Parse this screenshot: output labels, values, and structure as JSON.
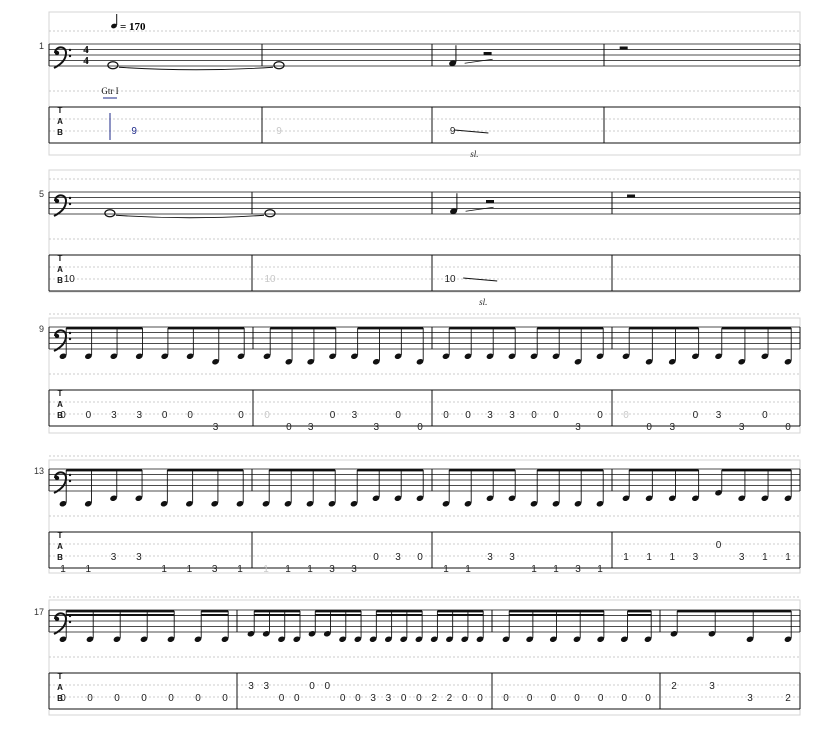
{
  "tempo": {
    "symbol": "♩",
    "text": "= 170"
  },
  "instrument_label": "Gtr I",
  "time_signature": {
    "top": "4",
    "bottom": "4"
  },
  "tab_letters": [
    "T",
    "A",
    "B"
  ],
  "slide_label": "sl.",
  "systems": [
    {
      "start_measure": "1",
      "tab_numbers": [
        {
          "m": 0,
          "p": 0.4,
          "text": "9",
          "line": "B",
          "style": "blue"
        },
        {
          "m": 1,
          "p": 0.1,
          "text": "9",
          "line": "B",
          "style": "ghost"
        },
        {
          "m": 2,
          "p": 0.12,
          "text": "9",
          "line": "B",
          "style": ""
        }
      ],
      "slides": [
        {
          "m": 2,
          "p": 0.2,
          "label_p": 0.2
        }
      ]
    },
    {
      "start_measure": "5",
      "tab_numbers": [
        {
          "m": 0,
          "p": 0.1,
          "text": "10",
          "line": "B",
          "style": ""
        },
        {
          "m": 1,
          "p": 0.1,
          "text": "10",
          "line": "B",
          "style": "ghost"
        },
        {
          "m": 2,
          "p": 0.1,
          "text": "10",
          "line": "B",
          "style": ""
        }
      ],
      "slides": [
        {
          "m": 2,
          "p": 0.24,
          "label_p": 0.22
        }
      ]
    },
    {
      "start_measure": "9",
      "measures": [
        [
          [
            "0",
            "A2"
          ],
          [
            "0",
            "A2"
          ],
          [
            "3",
            "A2"
          ],
          [
            "3",
            "A2"
          ],
          [
            "0",
            "A2"
          ],
          [
            "0",
            "A2"
          ],
          [
            "3",
            "B"
          ],
          [
            "0",
            "A2"
          ]
        ],
        [
          [
            "0",
            "A2g"
          ],
          [
            "0",
            "B"
          ],
          [
            "3",
            "B"
          ],
          [
            "0",
            "A2"
          ],
          [
            "3",
            "A2"
          ],
          [
            "3",
            "B"
          ],
          [
            "0",
            "A2"
          ],
          [
            "0",
            "B"
          ]
        ],
        [
          [
            "0",
            "A2"
          ],
          [
            "0",
            "A2"
          ],
          [
            "3",
            "A2"
          ],
          [
            "3",
            "A2"
          ],
          [
            "0",
            "A2"
          ],
          [
            "0",
            "A2"
          ],
          [
            "3",
            "B"
          ],
          [
            "0",
            "A2"
          ]
        ],
        [
          [
            "0",
            "A2g"
          ],
          [
            "0",
            "B"
          ],
          [
            "3",
            "B"
          ],
          [
            "0",
            "A2"
          ],
          [
            "3",
            "A2"
          ],
          [
            "3",
            "B"
          ],
          [
            "0",
            "A2"
          ],
          [
            "0",
            "B"
          ]
        ]
      ]
    },
    {
      "start_measure": "13",
      "measures": [
        [
          [
            "1",
            "B"
          ],
          [
            "1",
            "B"
          ],
          [
            "3",
            "A2"
          ],
          [
            "3",
            "A2"
          ],
          [
            "1",
            "B"
          ],
          [
            "1",
            "B"
          ],
          [
            "3",
            "B"
          ],
          [
            "1",
            "B"
          ]
        ],
        [
          [
            "1",
            "Bg"
          ],
          [
            "1",
            "B"
          ],
          [
            "1",
            "B"
          ],
          [
            "3",
            "B"
          ],
          [
            "3",
            "B"
          ],
          [
            "0",
            "A2"
          ],
          [
            "3",
            "A2"
          ],
          [
            "0",
            "A2"
          ]
        ],
        [
          [
            "1",
            "B"
          ],
          [
            "1",
            "B"
          ],
          [
            "3",
            "A2"
          ],
          [
            "3",
            "A2"
          ],
          [
            "1",
            "B"
          ],
          [
            "1",
            "B"
          ],
          [
            "3",
            "B"
          ],
          [
            "1",
            "B"
          ]
        ],
        [
          [
            "1",
            "A2"
          ],
          [
            "1",
            "A2"
          ],
          [
            "1",
            "A2"
          ],
          [
            "3",
            "A2"
          ],
          [
            "0",
            "A1"
          ],
          [
            "3",
            "A2"
          ],
          [
            "1",
            "A2"
          ],
          [
            "1",
            "A2"
          ]
        ]
      ]
    },
    {
      "start_measure": "17",
      "measures": [
        [
          [
            "0",
            "A2"
          ],
          [
            "0",
            "A2"
          ],
          [
            "0",
            "A2"
          ],
          [
            "0",
            "A2"
          ],
          [
            "0",
            "A2"
          ],
          [
            "0",
            "A2"
          ],
          [
            "0",
            "A2"
          ]
        ],
        [
          [
            "3",
            "A1"
          ],
          [
            "3",
            "A1"
          ],
          [
            "0",
            "A2"
          ],
          [
            "0",
            "A2"
          ],
          [
            "0",
            "A1"
          ],
          [
            "0",
            "A1"
          ],
          [
            "0",
            "A2"
          ],
          [
            "0",
            "A2"
          ],
          [
            "3",
            "A2"
          ],
          [
            "3",
            "A2"
          ],
          [
            "0",
            "A2"
          ],
          [
            "0",
            "A2"
          ],
          [
            "2",
            "A2"
          ],
          [
            "2",
            "A2"
          ],
          [
            "0",
            "A2"
          ],
          [
            "0",
            "A2"
          ]
        ],
        [
          [
            "0",
            "A2"
          ],
          [
            "0",
            "A2"
          ],
          [
            "0",
            "A2"
          ],
          [
            "0",
            "A2"
          ],
          [
            "0",
            "A2"
          ],
          [
            "0",
            "A2"
          ],
          [
            "0",
            "A2"
          ]
        ],
        [
          [
            "2",
            "A1"
          ],
          [
            "3",
            "A1"
          ],
          [
            "3",
            "A2"
          ],
          [
            "2",
            "A2"
          ]
        ]
      ]
    }
  ]
}
